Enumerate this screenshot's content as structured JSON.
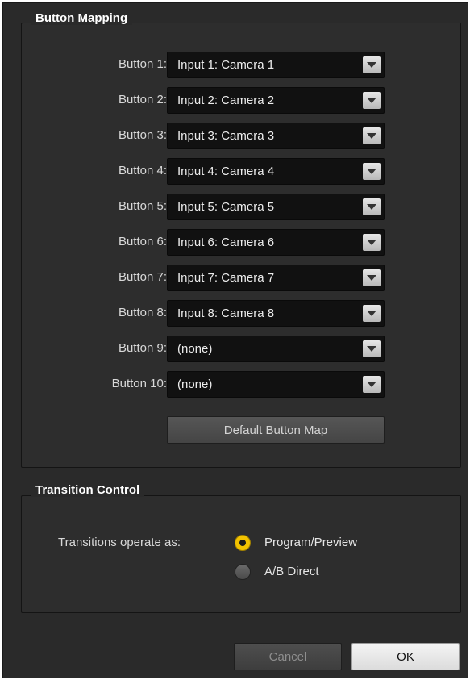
{
  "button_mapping": {
    "title": "Button Mapping",
    "rows": [
      {
        "label": "Button 1:",
        "value": "Input 1: Camera 1"
      },
      {
        "label": "Button 2:",
        "value": "Input 2: Camera 2"
      },
      {
        "label": "Button 3:",
        "value": "Input 3: Camera 3"
      },
      {
        "label": "Button 4:",
        "value": "Input 4: Camera 4"
      },
      {
        "label": "Button 5:",
        "value": "Input 5: Camera 5"
      },
      {
        "label": "Button 6:",
        "value": "Input 6: Camera 6"
      },
      {
        "label": "Button 7:",
        "value": "Input 7: Camera 7"
      },
      {
        "label": "Button 8:",
        "value": "Input 8: Camera 8"
      },
      {
        "label": "Button 9:",
        "value": "(none)"
      },
      {
        "label": "Button 10:",
        "value": "(none)"
      }
    ],
    "default_button": "Default Button Map"
  },
  "transition_control": {
    "title": "Transition Control",
    "label": "Transitions operate as:",
    "options": [
      {
        "label": "Program/Preview",
        "selected": true
      },
      {
        "label": "A/B Direct",
        "selected": false
      }
    ]
  },
  "footer": {
    "cancel_label": "Cancel",
    "ok_label": "OK"
  },
  "colors": {
    "background": "#2a2a2a",
    "select_background": "#111111",
    "radio_selected": "#f2c200",
    "text": "#d8d8d8"
  }
}
